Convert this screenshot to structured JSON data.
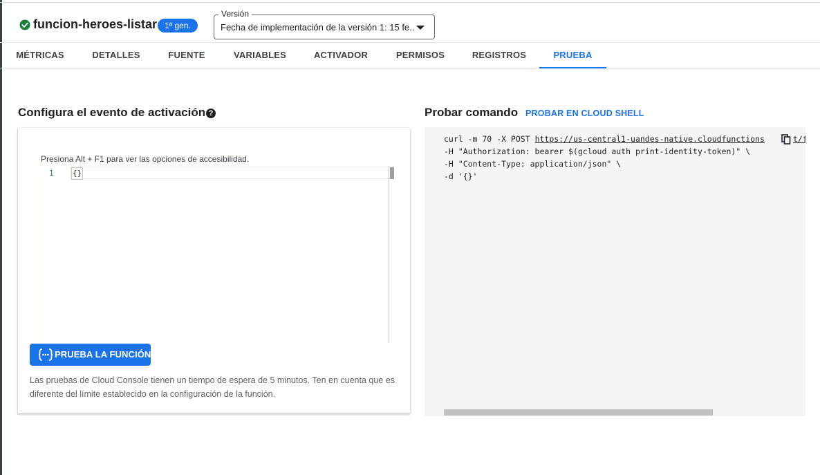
{
  "header": {
    "function_name": "funcion-heroes-listar",
    "gen_badge": "1ª gen.",
    "version_legend": "Versión",
    "version_value": "Fecha de implementación de la versión 1: 15 fe..."
  },
  "tabs": [
    {
      "label": "MÉTRICAS"
    },
    {
      "label": "DETALLES"
    },
    {
      "label": "FUENTE"
    },
    {
      "label": "VARIABLES"
    },
    {
      "label": "ACTIVADOR"
    },
    {
      "label": "PERMISOS"
    },
    {
      "label": "REGISTROS"
    },
    {
      "label": "PRUEBA"
    }
  ],
  "active_tab": "PRUEBA",
  "trigger": {
    "title": "Configura el evento de activación",
    "accessibility_hint": "Presiona Alt + F1 para ver las opciones de accesibilidad.",
    "line_number": "1",
    "code": "{}",
    "run_button_label": "PRUEBA LA FUNCIÓN",
    "note": "Las pruebas de Cloud Console tienen un tiempo de espera de 5 minutos. Ten en cuenta que es diferente del límite establecido en la configuración de la función."
  },
  "command": {
    "title": "Probar comando",
    "cloud_shell_link": "PROBAR EN CLOUD SHELL",
    "line1_prefix": "curl -m 70 -X POST ",
    "line1_url": "https://us-central1-uandes-native.cloudfunctions",
    "line1_tail": "t/f",
    "line2": "-H \"Authorization: bearer $(gcloud auth print-identity-token)\" \\",
    "line3": "-H \"Content-Type: application/json\" \\",
    "line4": "-d '{}'"
  },
  "colors": {
    "accent": "#1a73e8",
    "success": "#188038",
    "text": "#202124",
    "muted": "#5f6368"
  }
}
